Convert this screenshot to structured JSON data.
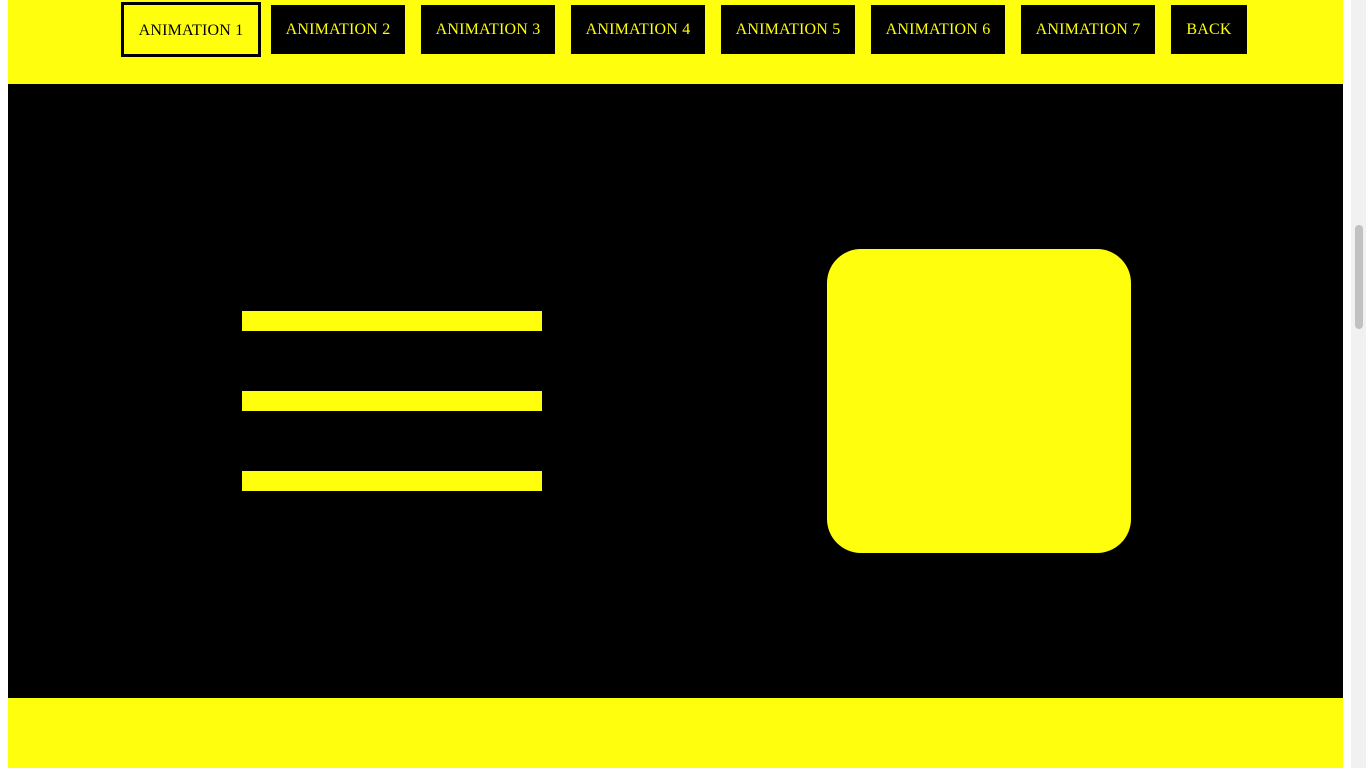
{
  "nav": {
    "buttons": [
      {
        "label": "ANIMATION 1",
        "active": true
      },
      {
        "label": "ANIMATION 2",
        "active": false
      },
      {
        "label": "ANIMATION 3",
        "active": false
      },
      {
        "label": "ANIMATION 4",
        "active": false
      },
      {
        "label": "ANIMATION 5",
        "active": false
      },
      {
        "label": "ANIMATION 6",
        "active": false
      },
      {
        "label": "ANIMATION 7",
        "active": false
      },
      {
        "label": "BACK",
        "active": false
      }
    ]
  },
  "colors": {
    "background": "#ffff0d",
    "stage": "#000000",
    "accent": "#ffff0d",
    "button_bg": "#000000"
  },
  "stage": {
    "hamburger_icon": "three-bar-menu",
    "shape_icon": "rounded-square"
  }
}
